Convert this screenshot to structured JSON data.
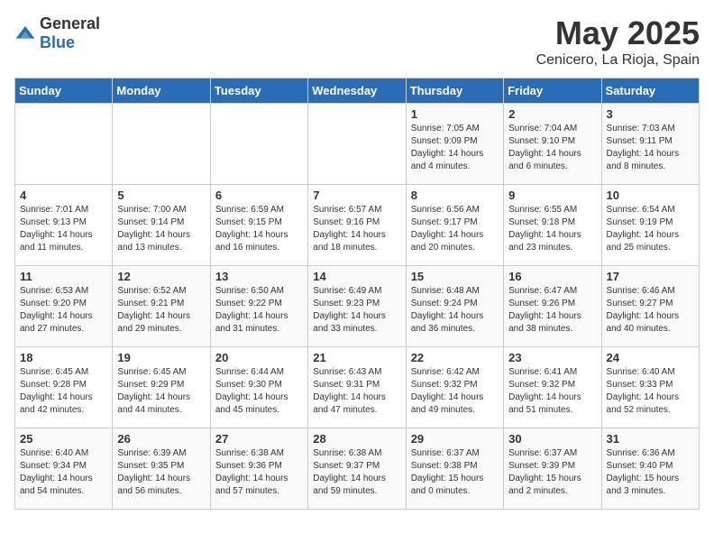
{
  "logo": {
    "general": "General",
    "blue": "Blue"
  },
  "title": "May 2025",
  "subtitle": "Cenicero, La Rioja, Spain",
  "days_header": [
    "Sunday",
    "Monday",
    "Tuesday",
    "Wednesday",
    "Thursday",
    "Friday",
    "Saturday"
  ],
  "weeks": [
    [
      {
        "day": "",
        "info": ""
      },
      {
        "day": "",
        "info": ""
      },
      {
        "day": "",
        "info": ""
      },
      {
        "day": "",
        "info": ""
      },
      {
        "day": "1",
        "info": "Sunrise: 7:05 AM\nSunset: 9:09 PM\nDaylight: 14 hours\nand 4 minutes."
      },
      {
        "day": "2",
        "info": "Sunrise: 7:04 AM\nSunset: 9:10 PM\nDaylight: 14 hours\nand 6 minutes."
      },
      {
        "day": "3",
        "info": "Sunrise: 7:03 AM\nSunset: 9:11 PM\nDaylight: 14 hours\nand 8 minutes."
      }
    ],
    [
      {
        "day": "4",
        "info": "Sunrise: 7:01 AM\nSunset: 9:13 PM\nDaylight: 14 hours\nand 11 minutes."
      },
      {
        "day": "5",
        "info": "Sunrise: 7:00 AM\nSunset: 9:14 PM\nDaylight: 14 hours\nand 13 minutes."
      },
      {
        "day": "6",
        "info": "Sunrise: 6:59 AM\nSunset: 9:15 PM\nDaylight: 14 hours\nand 16 minutes."
      },
      {
        "day": "7",
        "info": "Sunrise: 6:57 AM\nSunset: 9:16 PM\nDaylight: 14 hours\nand 18 minutes."
      },
      {
        "day": "8",
        "info": "Sunrise: 6:56 AM\nSunset: 9:17 PM\nDaylight: 14 hours\nand 20 minutes."
      },
      {
        "day": "9",
        "info": "Sunrise: 6:55 AM\nSunset: 9:18 PM\nDaylight: 14 hours\nand 23 minutes."
      },
      {
        "day": "10",
        "info": "Sunrise: 6:54 AM\nSunset: 9:19 PM\nDaylight: 14 hours\nand 25 minutes."
      }
    ],
    [
      {
        "day": "11",
        "info": "Sunrise: 6:53 AM\nSunset: 9:20 PM\nDaylight: 14 hours\nand 27 minutes."
      },
      {
        "day": "12",
        "info": "Sunrise: 6:52 AM\nSunset: 9:21 PM\nDaylight: 14 hours\nand 29 minutes."
      },
      {
        "day": "13",
        "info": "Sunrise: 6:50 AM\nSunset: 9:22 PM\nDaylight: 14 hours\nand 31 minutes."
      },
      {
        "day": "14",
        "info": "Sunrise: 6:49 AM\nSunset: 9:23 PM\nDaylight: 14 hours\nand 33 minutes."
      },
      {
        "day": "15",
        "info": "Sunrise: 6:48 AM\nSunset: 9:24 PM\nDaylight: 14 hours\nand 36 minutes."
      },
      {
        "day": "16",
        "info": "Sunrise: 6:47 AM\nSunset: 9:26 PM\nDaylight: 14 hours\nand 38 minutes."
      },
      {
        "day": "17",
        "info": "Sunrise: 6:46 AM\nSunset: 9:27 PM\nDaylight: 14 hours\nand 40 minutes."
      }
    ],
    [
      {
        "day": "18",
        "info": "Sunrise: 6:45 AM\nSunset: 9:28 PM\nDaylight: 14 hours\nand 42 minutes."
      },
      {
        "day": "19",
        "info": "Sunrise: 6:45 AM\nSunset: 9:29 PM\nDaylight: 14 hours\nand 44 minutes."
      },
      {
        "day": "20",
        "info": "Sunrise: 6:44 AM\nSunset: 9:30 PM\nDaylight: 14 hours\nand 45 minutes."
      },
      {
        "day": "21",
        "info": "Sunrise: 6:43 AM\nSunset: 9:31 PM\nDaylight: 14 hours\nand 47 minutes."
      },
      {
        "day": "22",
        "info": "Sunrise: 6:42 AM\nSunset: 9:32 PM\nDaylight: 14 hours\nand 49 minutes."
      },
      {
        "day": "23",
        "info": "Sunrise: 6:41 AM\nSunset: 9:32 PM\nDaylight: 14 hours\nand 51 minutes."
      },
      {
        "day": "24",
        "info": "Sunrise: 6:40 AM\nSunset: 9:33 PM\nDaylight: 14 hours\nand 52 minutes."
      }
    ],
    [
      {
        "day": "25",
        "info": "Sunrise: 6:40 AM\nSunset: 9:34 PM\nDaylight: 14 hours\nand 54 minutes."
      },
      {
        "day": "26",
        "info": "Sunrise: 6:39 AM\nSunset: 9:35 PM\nDaylight: 14 hours\nand 56 minutes."
      },
      {
        "day": "27",
        "info": "Sunrise: 6:38 AM\nSunset: 9:36 PM\nDaylight: 14 hours\nand 57 minutes."
      },
      {
        "day": "28",
        "info": "Sunrise: 6:38 AM\nSunset: 9:37 PM\nDaylight: 14 hours\nand 59 minutes."
      },
      {
        "day": "29",
        "info": "Sunrise: 6:37 AM\nSunset: 9:38 PM\nDaylight: 15 hours\nand 0 minutes."
      },
      {
        "day": "30",
        "info": "Sunrise: 6:37 AM\nSunset: 9:39 PM\nDaylight: 15 hours\nand 2 minutes."
      },
      {
        "day": "31",
        "info": "Sunrise: 6:36 AM\nSunset: 9:40 PM\nDaylight: 15 hours\nand 3 minutes."
      }
    ]
  ]
}
